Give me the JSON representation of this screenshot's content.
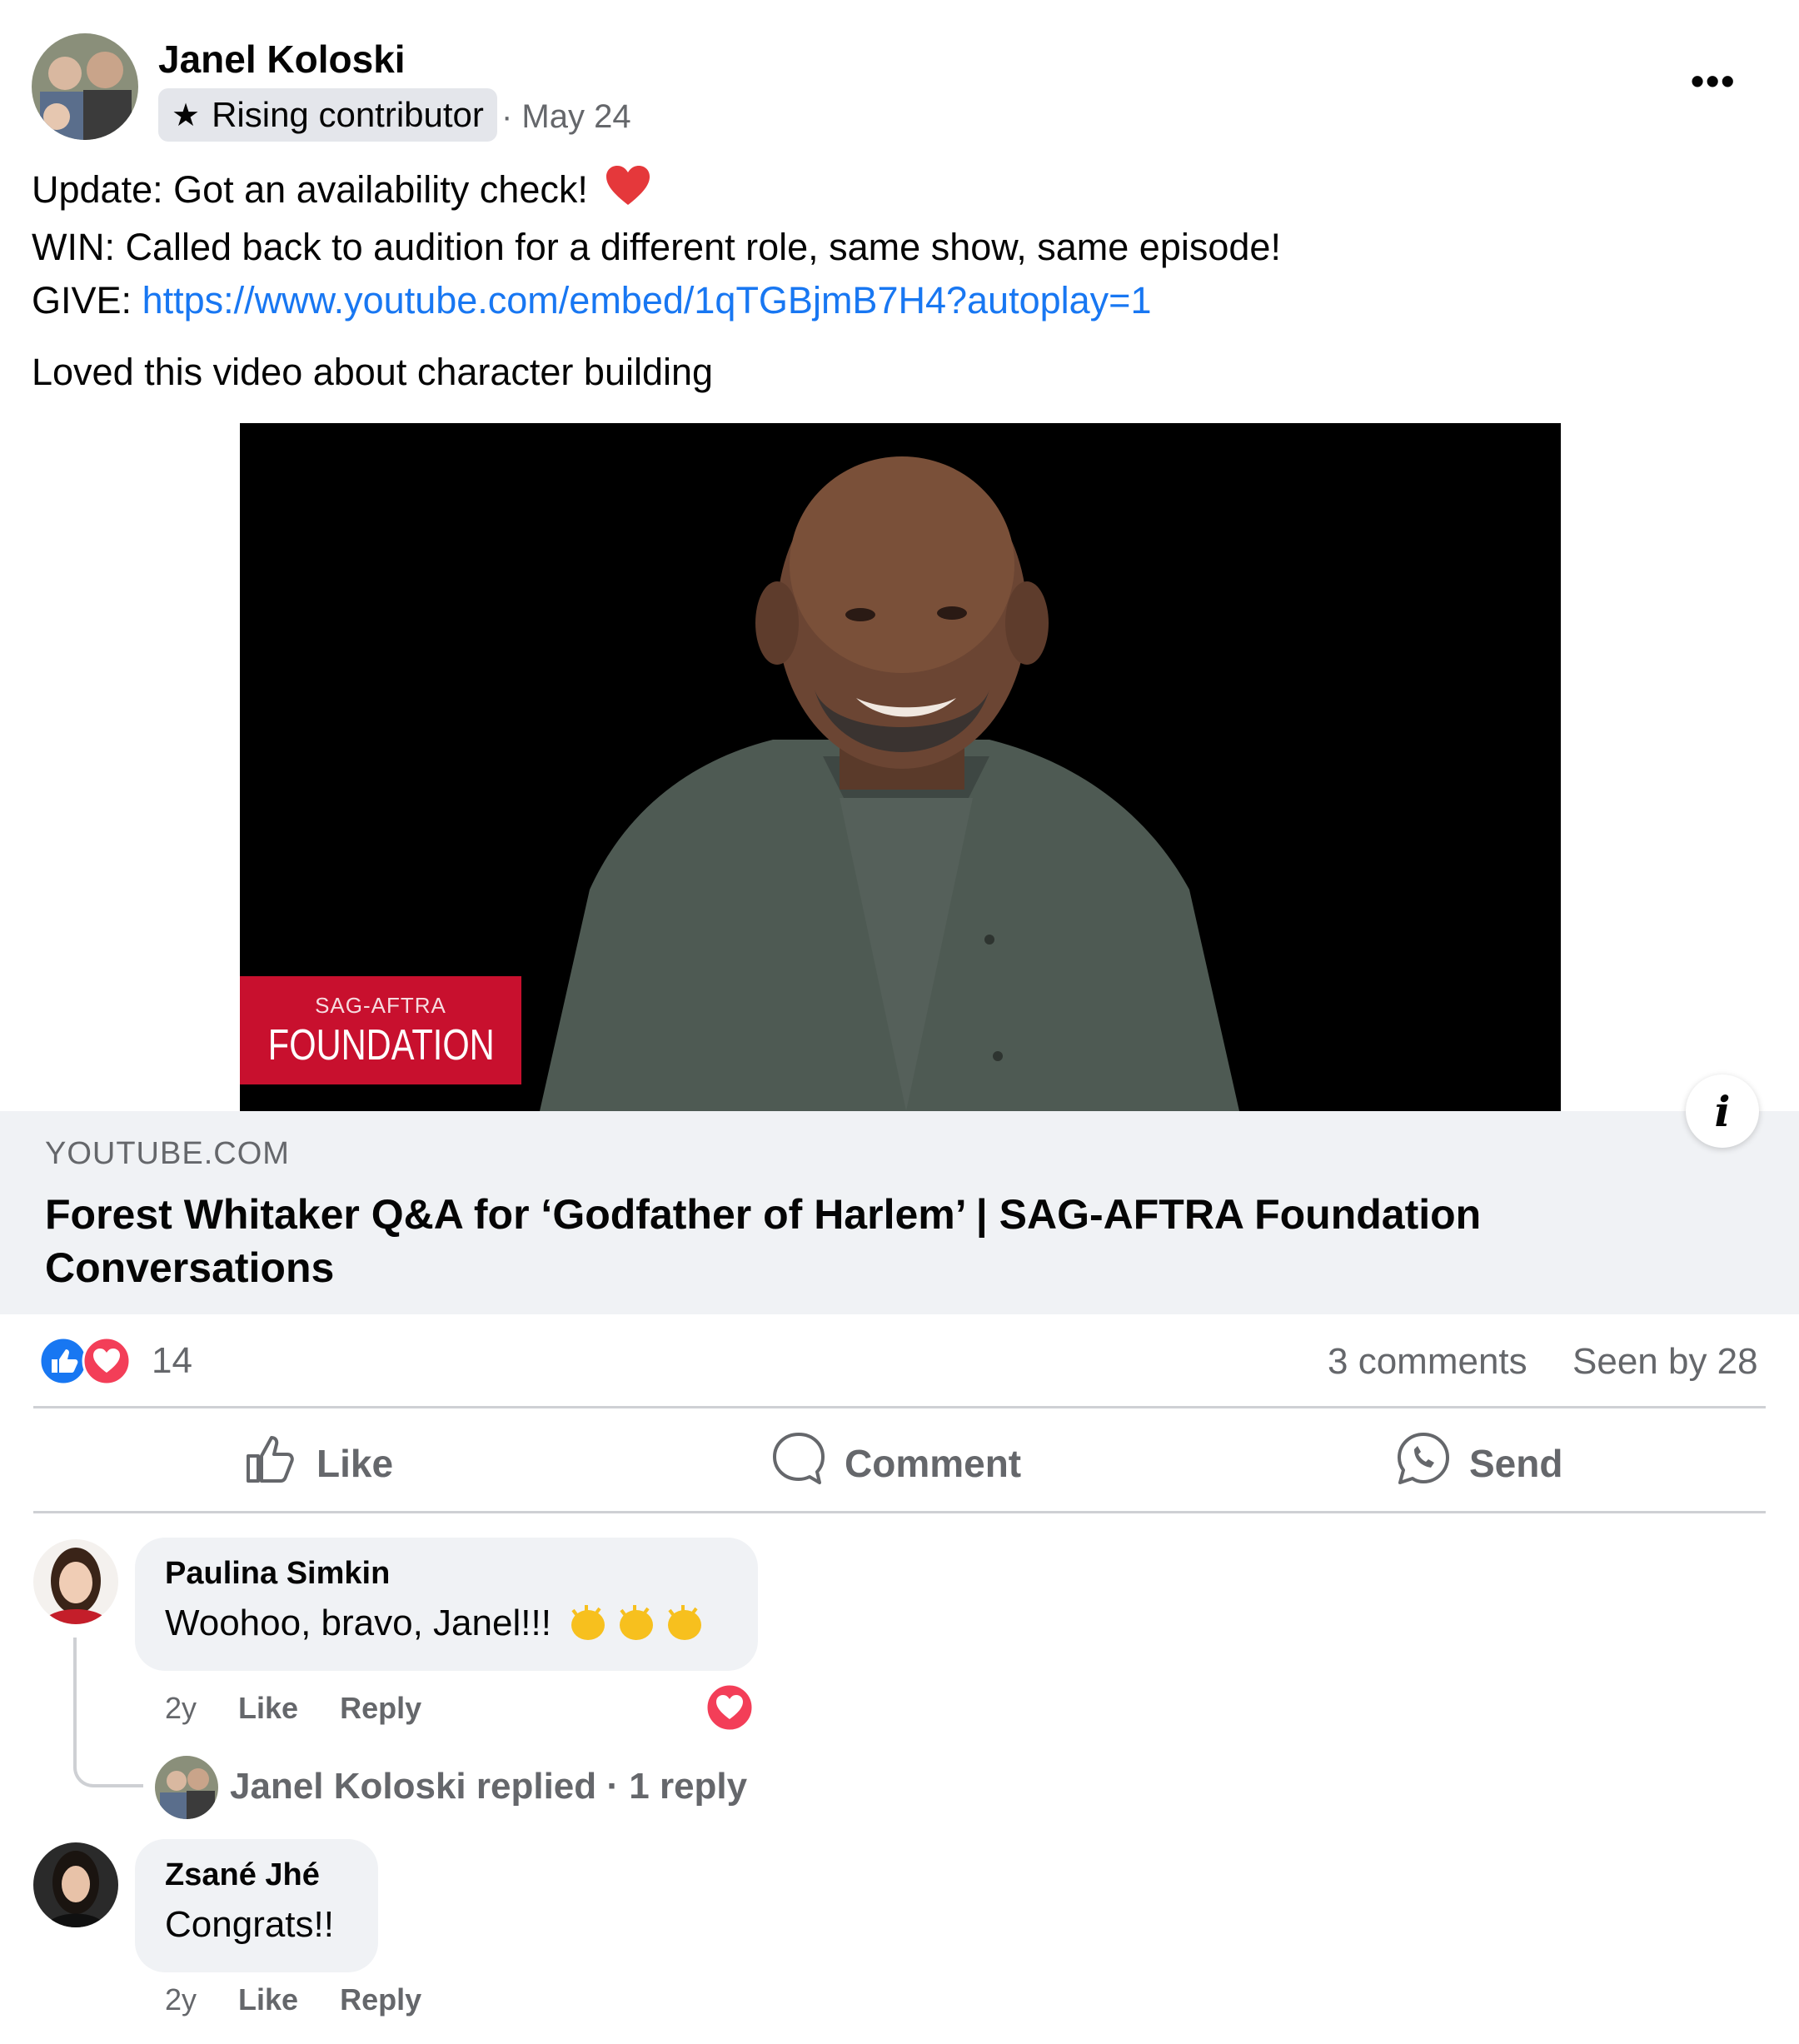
{
  "post": {
    "author": "Janel Koloski",
    "badge": "Rising contributor",
    "date": "· May 24",
    "line1": "Update: Got an availability check!",
    "line2": "WIN: Called back to audition for a different role, same show, same episode!",
    "line3_prefix": "GIVE:",
    "line3_link": "https://www.youtube.com/embed/1qTGBjmB7H4?autoplay=1",
    "line4": "Loved this video about character building"
  },
  "media": {
    "overlay_small": "SAG-AFTRA",
    "overlay_big": "FOUNDATION",
    "domain": "YOUTUBE.COM",
    "title_line1": "Forest Whitaker Q&A for ‘Godfather of Harlem’ | SAG-AFTRA Foundation",
    "title_line2": "Conversations"
  },
  "reactions": {
    "count": "14",
    "comments": "3 comments",
    "seen": "Seen by 28"
  },
  "actions": {
    "like": "Like",
    "comment": "Comment",
    "send": "Send"
  },
  "comments": [
    {
      "name": "Paulina Simkin",
      "text": "Woohoo, bravo, Janel!!!",
      "age": "2y",
      "like": "Like",
      "reply": "Reply",
      "replied": "Janel Koloski replied · 1 reply"
    },
    {
      "name": "Zsané Jhé",
      "text": "Congrats!!",
      "age": "2y",
      "like": "Like",
      "reply": "Reply"
    }
  ],
  "colors": {
    "link": "#1877f2",
    "like_blue": "#1877f2",
    "love_red": "#f33e58",
    "foundation_red": "#c8102e"
  },
  "icons": [
    "star-icon",
    "more-icon",
    "heart-emoji-icon",
    "info-icon",
    "like-reaction-icon",
    "love-reaction-icon",
    "thumbs-up-icon",
    "comment-icon",
    "send-icon",
    "clap-emoji-icon"
  ]
}
